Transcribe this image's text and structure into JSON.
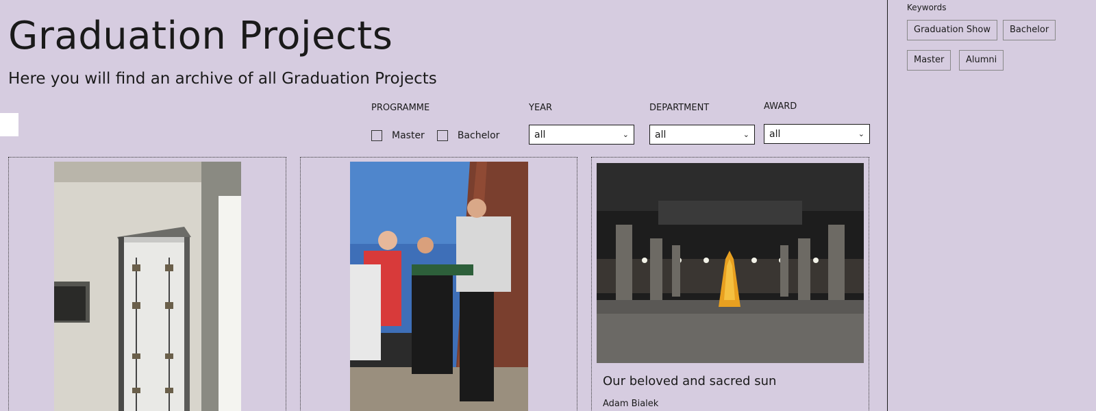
{
  "header": {
    "title": "Graduation Projects",
    "subtitle": "Here you will find an archive of all Graduation Projects"
  },
  "filters": {
    "programme_label": "PROGRAMME",
    "programme_options": [
      "Master",
      "Bachelor"
    ],
    "year_label": "YEAR",
    "year_value": "all",
    "department_label": "DEPARTMENT",
    "department_value": "all",
    "award_label": "AWARD",
    "award_value": "all"
  },
  "projects": [
    {
      "title": "",
      "author": ""
    },
    {
      "title": "",
      "author": ""
    },
    {
      "title": "Our beloved and sacred sun",
      "author": "Adam Bialek"
    }
  ],
  "sidebar": {
    "keywords_heading": "Keywords",
    "keywords": [
      "Graduation Show",
      "Bachelor",
      "Master",
      "Alumni"
    ]
  },
  "colors": {
    "background": "#d6cce0",
    "text": "#1a1a1a",
    "select_bg": "#ffffff"
  }
}
